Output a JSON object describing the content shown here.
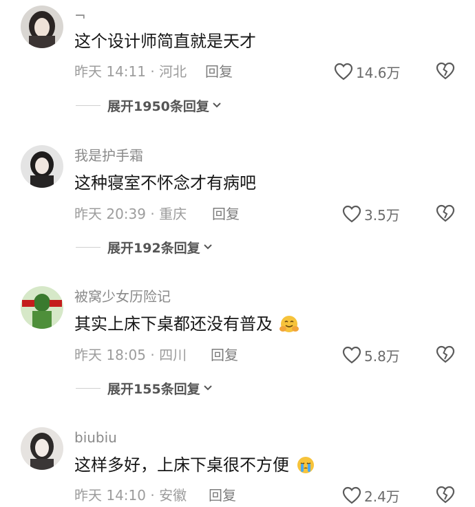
{
  "comments": [
    {
      "username": "¬",
      "text": "这个设计师简直就是天才",
      "meta": "昨天 14:11 · 河北",
      "reply": "回复",
      "likes": "14.6万",
      "expand": "展开1950条回复",
      "emoji": ""
    },
    {
      "username": "我是护手霜",
      "text": "这种寝室不怀念才有病吧",
      "meta": "昨天 20:39 · 重庆",
      "reply": "回复",
      "likes": "3.5万",
      "expand": "展开192条回复",
      "emoji": ""
    },
    {
      "username": "被窝少女历险记",
      "text": "其实上床下桌都还没有普及",
      "meta": "昨天 18:05 · 四川",
      "reply": "回复",
      "likes": "5.8万",
      "expand": "展开155条回复",
      "emoji": "hugging-face"
    },
    {
      "username": "biubiu",
      "text": "这样多好，上床下桌很不方便",
      "meta": "昨天 14:10 · 安徽",
      "reply": "回复",
      "likes": "2.4万",
      "expand": "",
      "emoji": "crying-face"
    }
  ],
  "colors": {
    "text": "#161616",
    "meta": "#9c9c9c",
    "username": "#8a8a8a"
  },
  "icons": [
    "heart-outline-icon",
    "broken-heart-icon",
    "chevron-down-icon"
  ]
}
